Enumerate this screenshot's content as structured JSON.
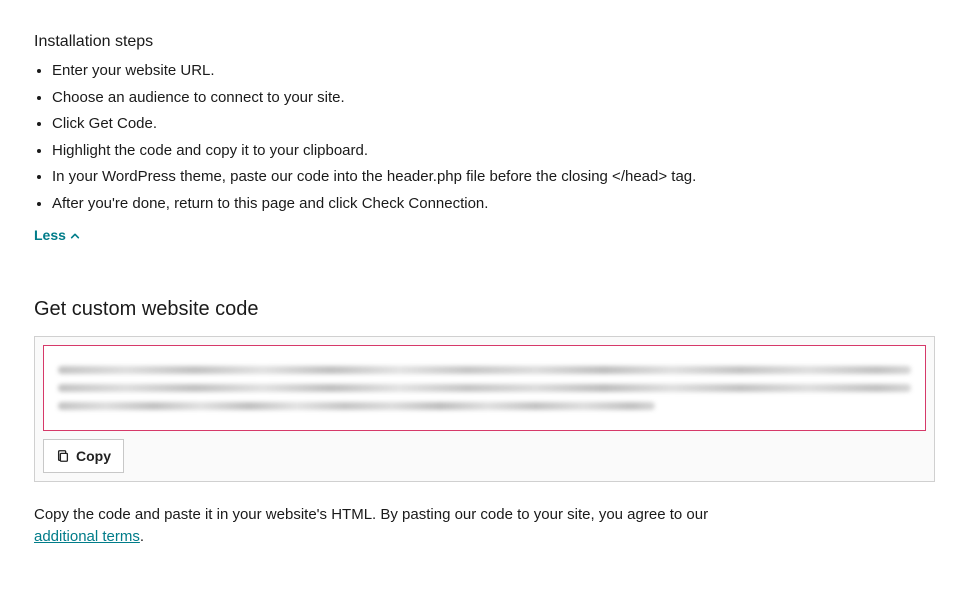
{
  "heading": "Installation steps",
  "steps": [
    "Enter your website URL.",
    "Choose an audience to connect to your site.",
    "Click Get Code.",
    "Highlight the code and copy it to your clipboard.",
    "In your WordPress theme, paste our code into the header.php file before the closing </head> tag.",
    "After you're done, return to this page and click Check Connection."
  ],
  "less_label": "Less",
  "sub_heading": "Get custom website code",
  "copy_label": "Copy",
  "footer_pre": "Copy the code and paste it in your website's HTML. By pasting our code to your site, you agree to our ",
  "footer_link": "additional terms",
  "footer_post": "."
}
